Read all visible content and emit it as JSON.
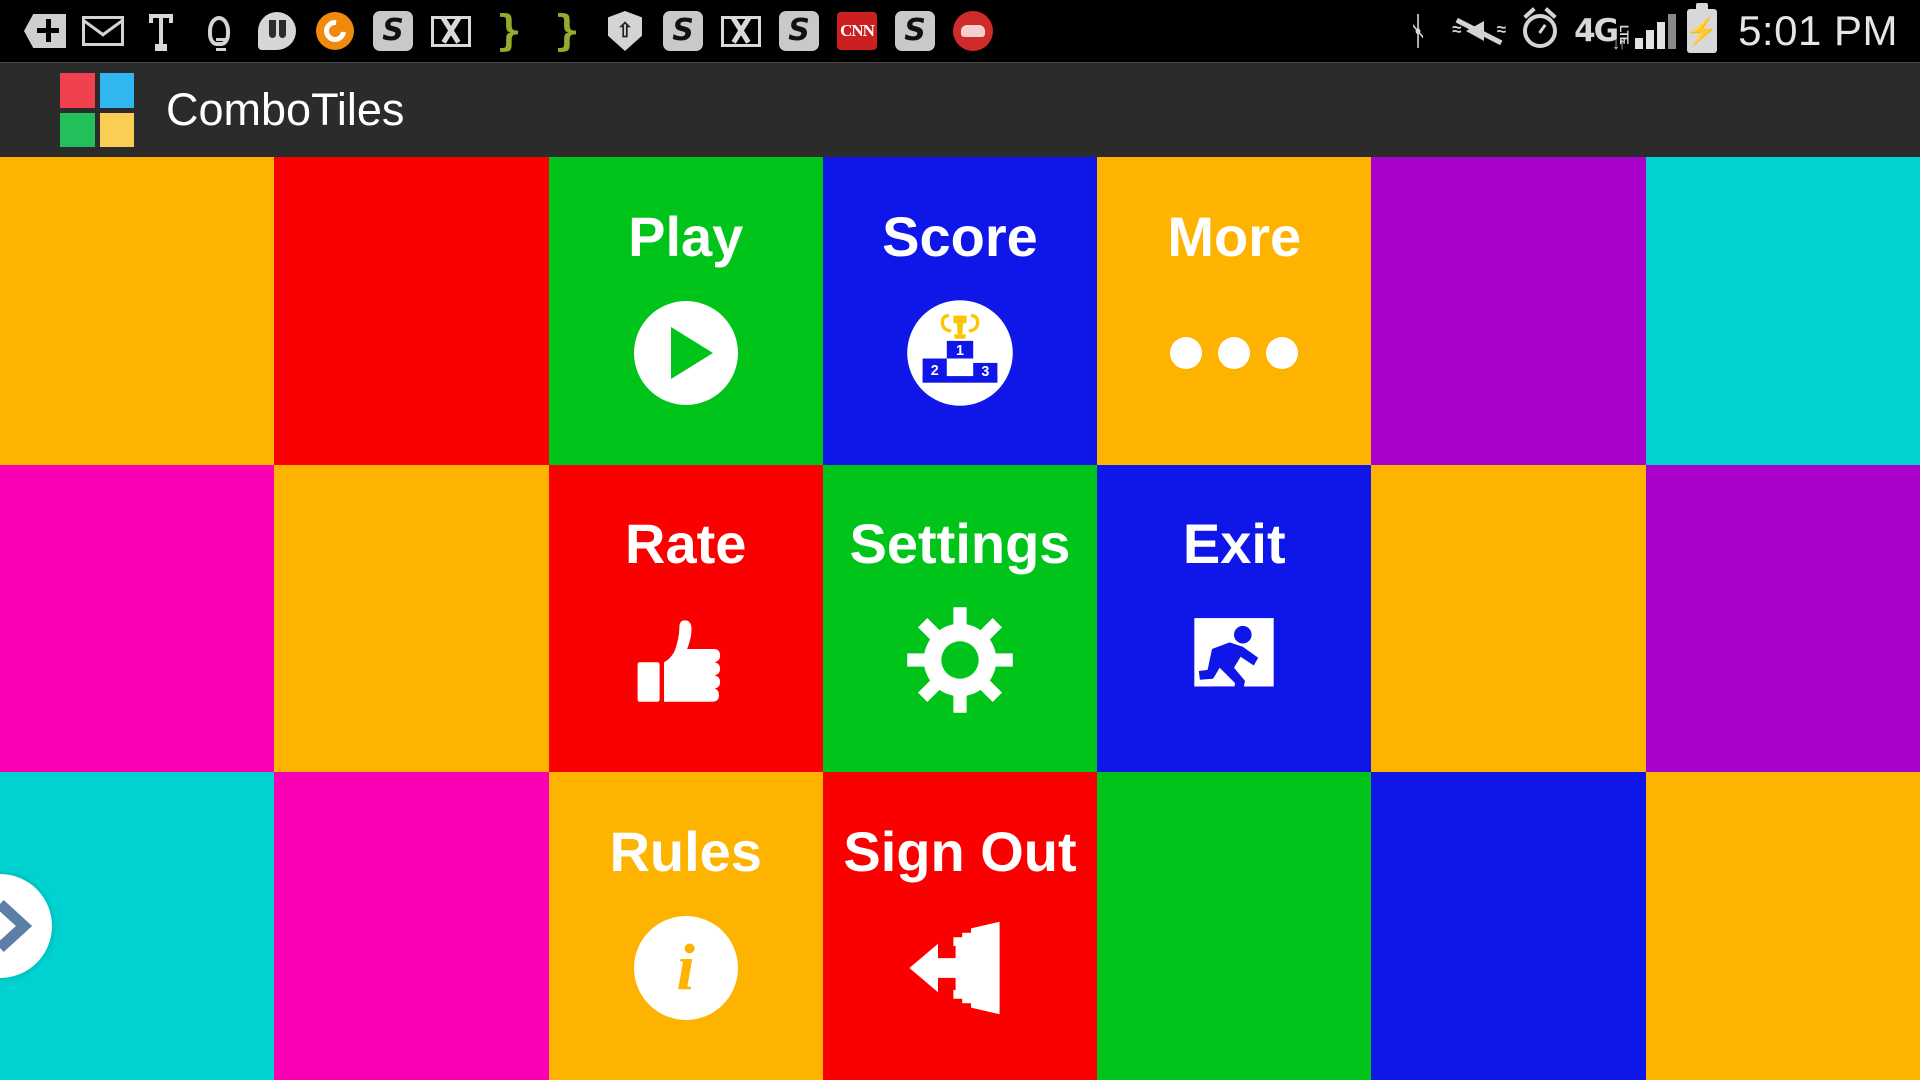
{
  "status_bar": {
    "time": "5:01 PM",
    "network_type": "4G",
    "network_sub": "LTE",
    "left_icons": [
      {
        "name": "add-tag-icon",
        "label": "+"
      },
      {
        "name": "email-icon",
        "label": "envelope"
      },
      {
        "name": "usb-debug-icon",
        "label": "usb"
      },
      {
        "name": "lightbulb-icon",
        "label": "bulb"
      },
      {
        "name": "hangouts-icon",
        "label": "hangouts"
      },
      {
        "name": "ring-app-icon",
        "label": "ring"
      },
      {
        "name": "skype-message-icon",
        "label": "S"
      },
      {
        "name": "gmail-icon",
        "label": "M"
      },
      {
        "name": "brace-icon-1",
        "label": "}"
      },
      {
        "name": "brace-icon-2",
        "label": "}"
      },
      {
        "name": "shield-update-icon",
        "label": "shield"
      },
      {
        "name": "skype-message-icon-2",
        "label": "S"
      },
      {
        "name": "gmail-icon-2",
        "label": "M"
      },
      {
        "name": "skype-message-icon-3",
        "label": "S"
      },
      {
        "name": "cnn-news-icon",
        "label": "CNN"
      },
      {
        "name": "skype-message-icon-4",
        "label": "S"
      },
      {
        "name": "car-app-icon",
        "label": "car"
      }
    ],
    "right_icons": [
      {
        "name": "bluetooth-icon",
        "label": "bluetooth"
      },
      {
        "name": "vibrate-mute-icon",
        "label": "mute"
      },
      {
        "name": "alarm-clock-icon",
        "label": "alarm"
      },
      {
        "name": "signal-bars-icon",
        "label": "signal"
      },
      {
        "name": "battery-charging-icon",
        "label": "battery"
      }
    ]
  },
  "app_bar": {
    "title": "ComboTiles",
    "logo_colors": [
      "#f2414e",
      "#30b7f0",
      "#22bf5b",
      "#f9ce52"
    ],
    "background": "#2b2b2b"
  },
  "palette": {
    "orange": "#fdb300",
    "red": "#fa0000",
    "green": "#00c41a",
    "blue": "#0f17e8",
    "purple": "#aa00cc",
    "cyan": "#00d2d2",
    "magenta": "#fa00b4"
  },
  "drawer_handle": {
    "name": "drawer-open-handle",
    "icon": "chevron-right-icon",
    "chevron_color": "#5b7fa6"
  },
  "grid": {
    "columns": 7,
    "rows": 3,
    "tiles": [
      {
        "row": 1,
        "col": 1,
        "color": "#fdb300",
        "label": "",
        "icon": ""
      },
      {
        "row": 1,
        "col": 2,
        "color": "#fa0000",
        "label": "",
        "icon": ""
      },
      {
        "row": 1,
        "col": 3,
        "color": "#00c41a",
        "label": "Play",
        "icon": "play-icon"
      },
      {
        "row": 1,
        "col": 4,
        "color": "#0f17e8",
        "label": "Score",
        "icon": "podium-trophy-icon"
      },
      {
        "row": 1,
        "col": 5,
        "color": "#fdb300",
        "label": "More",
        "icon": "ellipsis-icon"
      },
      {
        "row": 1,
        "col": 6,
        "color": "#aa00cc",
        "label": "",
        "icon": ""
      },
      {
        "row": 1,
        "col": 7,
        "color": "#00d2d2",
        "label": "",
        "icon": ""
      },
      {
        "row": 2,
        "col": 1,
        "color": "#fa00b4",
        "label": "",
        "icon": ""
      },
      {
        "row": 2,
        "col": 2,
        "color": "#fdb300",
        "label": "",
        "icon": ""
      },
      {
        "row": 2,
        "col": 3,
        "color": "#fa0000",
        "label": "Rate",
        "icon": "thumbs-up-icon"
      },
      {
        "row": 2,
        "col": 4,
        "color": "#00c41a",
        "label": "Settings",
        "icon": "gear-icon"
      },
      {
        "row": 2,
        "col": 5,
        "color": "#0f17e8",
        "label": "Exit",
        "icon": "exit-running-icon"
      },
      {
        "row": 2,
        "col": 6,
        "color": "#fdb300",
        "label": "",
        "icon": ""
      },
      {
        "row": 2,
        "col": 7,
        "color": "#aa00cc",
        "label": "",
        "icon": ""
      },
      {
        "row": 3,
        "col": 1,
        "color": "#00d2d2",
        "label": "",
        "icon": ""
      },
      {
        "row": 3,
        "col": 2,
        "color": "#fa00b4",
        "label": "",
        "icon": ""
      },
      {
        "row": 3,
        "col": 3,
        "color": "#fdb300",
        "label": "Rules",
        "icon": "info-icon"
      },
      {
        "row": 3,
        "col": 4,
        "color": "#fa0000",
        "label": "Sign Out",
        "icon": "sign-out-icon"
      },
      {
        "row": 3,
        "col": 5,
        "color": "#00c41a",
        "label": "",
        "icon": ""
      },
      {
        "row": 3,
        "col": 6,
        "color": "#0f17e8",
        "label": "",
        "icon": ""
      },
      {
        "row": 3,
        "col": 7,
        "color": "#fdb300",
        "label": "",
        "icon": ""
      }
    ]
  },
  "score_icon": {
    "ranks": [
      "1",
      "2",
      "3"
    ],
    "podium_color": "#0f17e8",
    "trophy_color": "#ffc400"
  }
}
